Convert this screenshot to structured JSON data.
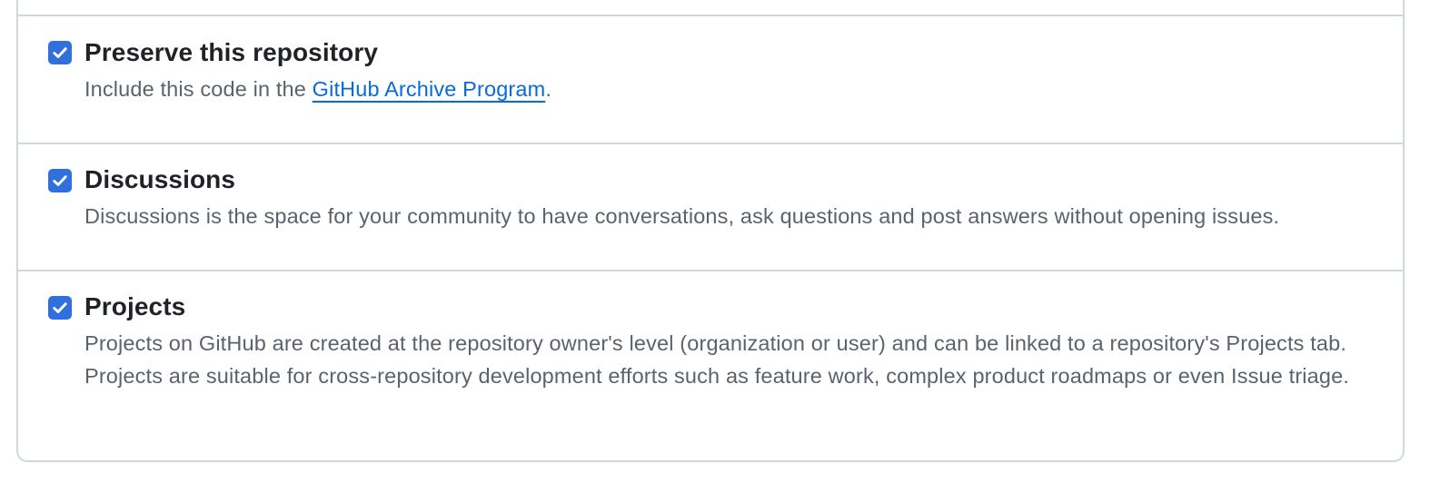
{
  "settings": {
    "preserve": {
      "title": "Preserve this repository",
      "desc_prefix": "Include this code in the ",
      "link_text": "GitHub Archive Program",
      "desc_suffix": ".",
      "checked": true
    },
    "discussions": {
      "title": "Discussions",
      "desc": "Discussions is the space for your community to have conversations, ask questions and post answers without opening issues.",
      "checked": true
    },
    "projects": {
      "title": "Projects",
      "desc": "Projects on GitHub are created at the repository owner's level (organization or user) and can be linked to a repository's Projects tab. Projects are suitable for cross-repository development efforts such as feature work, complex product roadmaps or even Issue triage.",
      "checked": true
    }
  },
  "colors": {
    "checkbox": "#2f6fde",
    "link": "#0969da",
    "border": "#d0d7de",
    "title": "#1f2328",
    "description": "#59636e"
  },
  "icons": {
    "checkbox_mark": "check-icon"
  }
}
